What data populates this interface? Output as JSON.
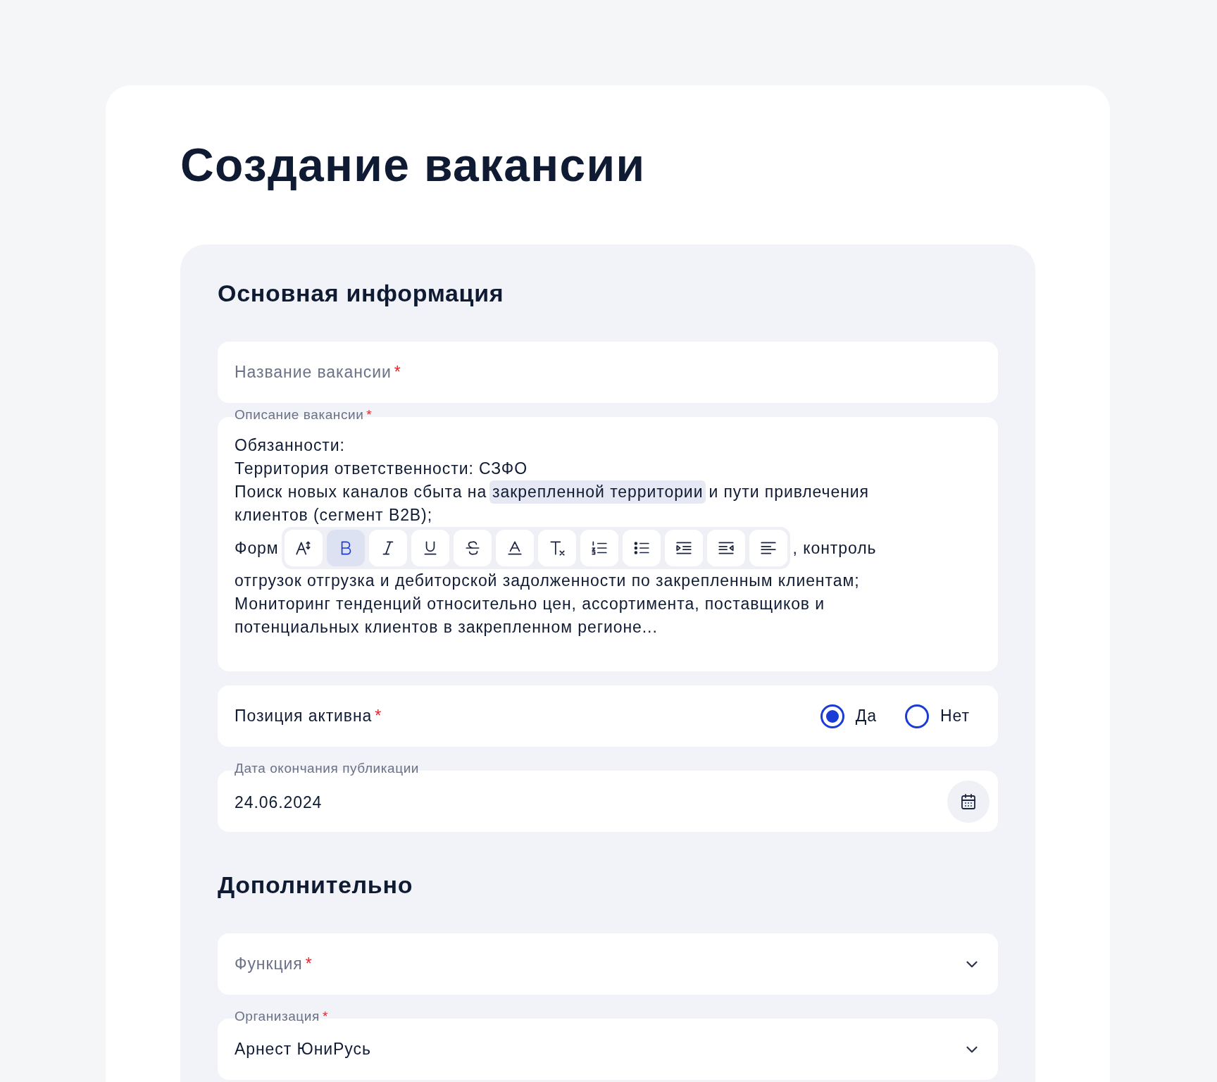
{
  "page_title": "Создание вакансии",
  "sections": [
    {
      "title": "Основная информация",
      "fields": [
        {
          "kind": "text",
          "placeholder": "Название вакансии",
          "required_mark": "*"
        },
        {
          "kind": "editor",
          "label": "Описание вакансии",
          "required_mark": "*",
          "lines": [
            {
              "segments": [
                {
                  "kind": "text",
                  "text": "Обязанности:"
                }
              ]
            },
            {
              "segments": [
                {
                  "kind": "text",
                  "text": "Территория ответственности: СЗФО"
                }
              ]
            },
            {
              "segments": [
                {
                  "kind": "text",
                  "text": "Поиск новых каналов сбыта на"
                },
                {
                  "kind": "highlight",
                  "text": "закрепленной территории"
                },
                {
                  "kind": "text",
                  "text": "и пути привлечения"
                }
              ]
            },
            {
              "segments": [
                {
                  "kind": "text",
                  "text": "клиентов (сегмент B2B);"
                }
              ]
            },
            {
              "segments": [
                {
                  "kind": "text",
                  "text": "Форм"
                },
                {
                  "kind": "toolbar"
                },
                {
                  "kind": "text",
                  "text": ", контроль"
                }
              ]
            },
            {
              "segments": [
                {
                  "kind": "text",
                  "text": "отгрузок отгрузка и дебиторской задолженности по закрепленным клиентам;"
                }
              ]
            },
            {
              "segments": [
                {
                  "kind": "text",
                  "text": "Мониторинг тенденций относительно цен, ассортимента, поставщиков и"
                }
              ]
            },
            {
              "segments": [
                {
                  "kind": "text",
                  "text": "потенциальных клиентов в закрепленном регионе..."
                }
              ]
            }
          ],
          "toolbar": [
            {
              "kind": "font-size",
              "selected": false
            },
            {
              "kind": "bold",
              "selected": true
            },
            {
              "kind": "italic",
              "selected": false
            },
            {
              "kind": "underline",
              "selected": false
            },
            {
              "kind": "strike",
              "selected": false
            },
            {
              "kind": "text-color",
              "selected": false
            },
            {
              "kind": "clear-format",
              "selected": false
            },
            {
              "kind": "ordered-list",
              "selected": false
            },
            {
              "kind": "bullet-list",
              "selected": false
            },
            {
              "kind": "indent",
              "selected": false
            },
            {
              "kind": "outdent",
              "selected": false
            },
            {
              "kind": "align-left",
              "selected": false
            }
          ]
        },
        {
          "kind": "radio",
          "label": "Позиция активна",
          "required_mark": "*",
          "options": [
            {
              "label": "Да",
              "selected": true
            },
            {
              "label": "Нет",
              "selected": false
            }
          ]
        },
        {
          "kind": "date",
          "label": "Дата окончания публикации",
          "value": "24.06.2024"
        }
      ]
    },
    {
      "title": "Дополнительно",
      "fields": [
        {
          "kind": "select",
          "placeholder": "Функция",
          "required_mark": "*"
        },
        {
          "kind": "select",
          "label": "Организация",
          "required_mark": "*",
          "value": "Арнест ЮниРусь"
        }
      ]
    }
  ]
}
